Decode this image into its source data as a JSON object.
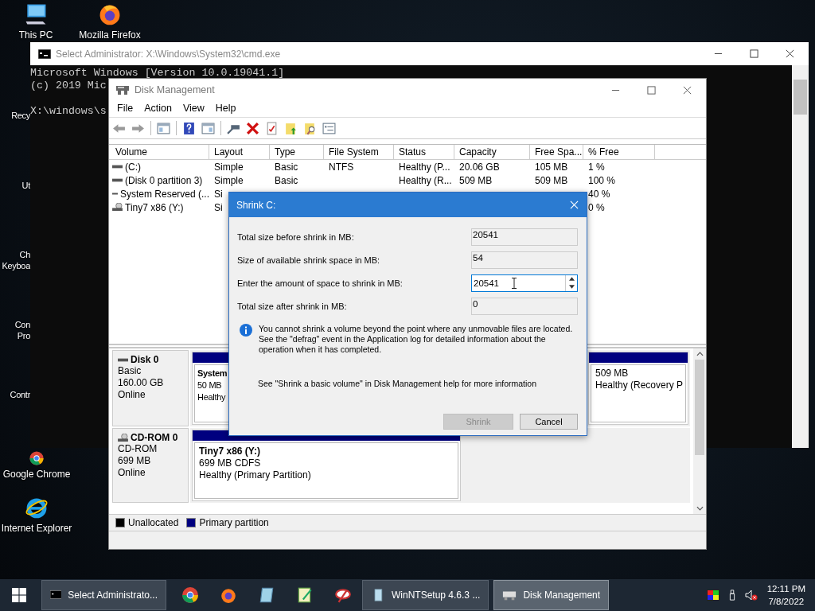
{
  "desktop_icons": [
    {
      "kind": "full",
      "label_lines": [
        "This PC"
      ]
    },
    {
      "kind": "full",
      "label_lines": [
        "Mozilla Firefox"
      ]
    },
    {
      "kind": "cut",
      "label_lines": [
        "Recy"
      ]
    },
    {
      "kind": "cut",
      "label_lines": [
        "Ut"
      ]
    },
    {
      "kind": "cut",
      "label_lines": [
        "Ch",
        "Keyboa"
      ]
    },
    {
      "kind": "cut",
      "label_lines": [
        "Con",
        "Pro"
      ]
    },
    {
      "kind": "cut",
      "label_lines": [
        "Contr"
      ]
    },
    {
      "kind": "full",
      "label_lines": [
        "Google Chrome"
      ]
    },
    {
      "kind": "full",
      "label_lines": [
        "Internet Explorer"
      ]
    }
  ],
  "cmd_window": {
    "title": "Select Administrator: X:\\Windows\\System32\\cmd.exe",
    "lines": [
      {
        "kind": "output",
        "text": "Microsoft Windows [Version 10.0.19041.1]"
      },
      {
        "kind": "output",
        "text": "(c) 2019 Mic"
      },
      {
        "kind": "prompt",
        "text": "X:\\windows\\s"
      }
    ]
  },
  "disk_management": {
    "title": "Disk Management",
    "menu": [
      "File",
      "Action",
      "View",
      "Help"
    ],
    "table": {
      "columns": [
        "Volume",
        "Layout",
        "Type",
        "File System",
        "Status",
        "Capacity",
        "Free Spa...",
        "% Free"
      ],
      "rows": [
        {
          "cells": [
            "(C:)",
            "Simple",
            "Basic",
            "NTFS",
            "Healthy (P...",
            "20.06 GB",
            "105 MB",
            "1 %"
          ]
        },
        {
          "cells": [
            "(Disk 0 partition 3)",
            "Simple",
            "Basic",
            null,
            "Healthy (R...",
            "509 MB",
            "509 MB",
            "100 %"
          ]
        },
        {
          "cells": [
            "System Reserved (...",
            "Si",
            null,
            null,
            null,
            null,
            null,
            "40 %"
          ]
        },
        {
          "cells": [
            "Tiny7 x86 (Y:)",
            "Si",
            null,
            null,
            null,
            null,
            null,
            "0 %"
          ]
        }
      ]
    },
    "disks": [
      {
        "name": "Disk 0",
        "lines": [
          "Basic",
          "160.00 GB",
          "Online"
        ],
        "partitions": [
          {
            "name": "System",
            "lines": [
              "50 MB",
              "Healthy"
            ]
          },
          {
            "lines": [
              "509 MB",
              "Healthy (Recovery P"
            ]
          }
        ]
      },
      {
        "name": "CD-ROM 0",
        "lines": [
          "CD-ROM",
          "699 MB",
          "Online"
        ],
        "partitions": [
          {
            "name": "Tiny7 x86  (Y:)",
            "lines": [
              "699 MB CDFS",
              "Healthy (Primary Partition)"
            ]
          }
        ]
      }
    ],
    "legend": [
      {
        "label": "Unallocated",
        "color": "#000000"
      },
      {
        "label": "Primary partition",
        "color": "#00007f"
      }
    ]
  },
  "dialog": {
    "title": "Shrink C:",
    "fields": [
      {
        "kind": "readonly",
        "label": "Total size before shrink in MB:",
        "value": "20541"
      },
      {
        "kind": "readonly",
        "label": "Size of available shrink space in MB:",
        "value": "54"
      },
      {
        "kind": "spin",
        "label": "Enter the amount of space to shrink in MB:",
        "value": "20541"
      },
      {
        "kind": "readonly",
        "label": "Total size after shrink in MB:",
        "value": "0"
      }
    ],
    "info": "You cannot shrink a volume beyond the point where any unmovable files are located. See the \"defrag\" event in the Application log for detailed information about the operation when it has completed.",
    "help": "See \"Shrink a basic volume\" in Disk Management help for more information",
    "buttons": [
      {
        "label": "Shrink",
        "disabled": true
      },
      {
        "label": "Cancel",
        "disabled": false
      }
    ]
  },
  "taskbar": {
    "items": [
      {
        "kind": "window",
        "label": "Select Administrato...",
        "selected": false
      },
      {
        "kind": "pinned"
      },
      {
        "kind": "pinned"
      },
      {
        "kind": "pinned"
      },
      {
        "kind": "pinned"
      },
      {
        "kind": "pinned"
      },
      {
        "kind": "window",
        "label": "WinNTSetup 4.6.3  ...",
        "selected": false
      },
      {
        "kind": "window",
        "label": "Disk Management",
        "selected": true
      }
    ],
    "time": "12:11 PM",
    "date": "7/8/2022"
  }
}
